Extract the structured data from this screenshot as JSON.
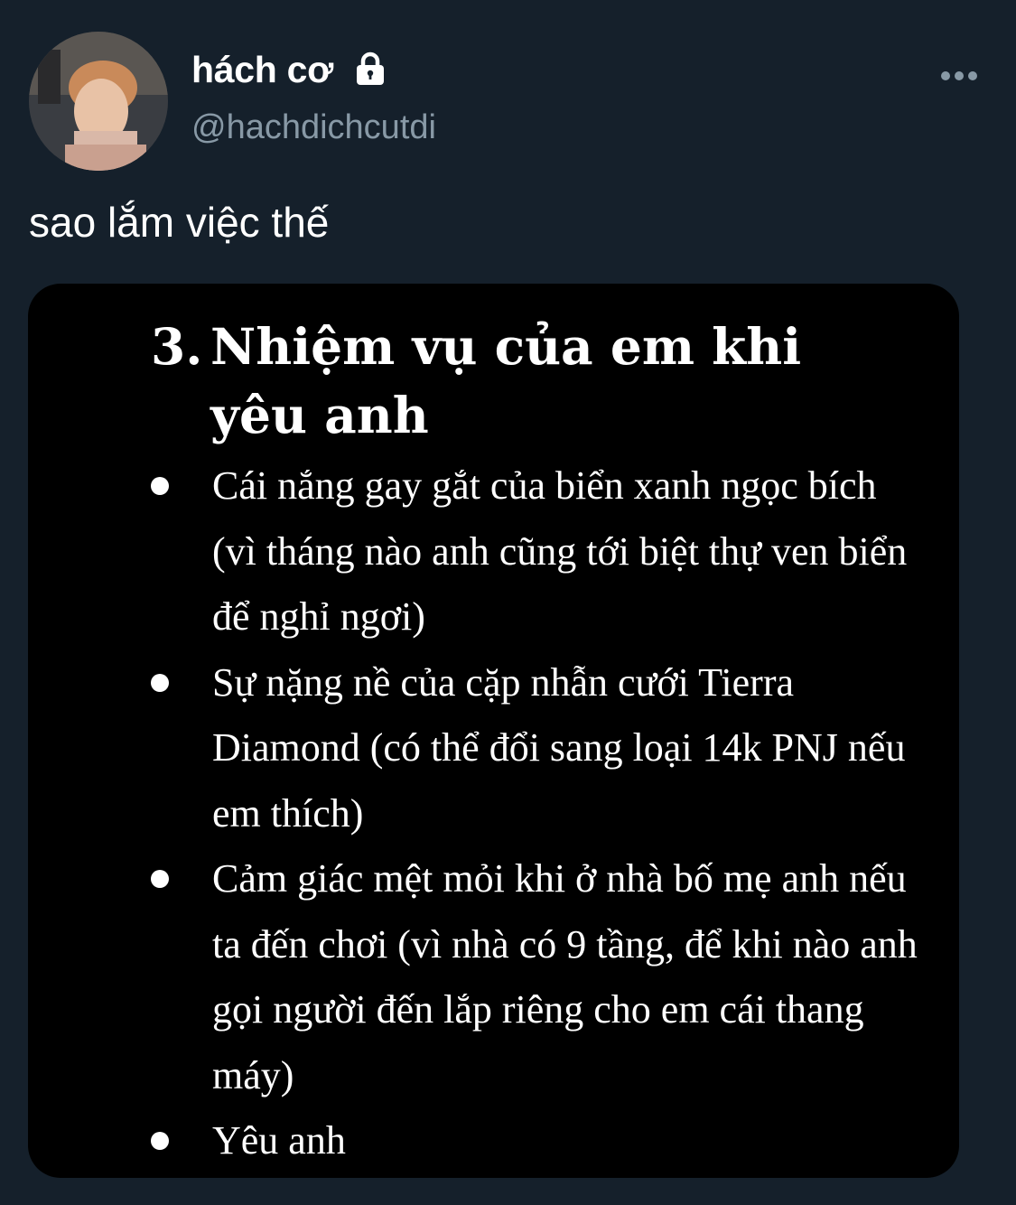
{
  "user": {
    "display_name": "hách cơ",
    "handle": "@hachdichcutdi",
    "protected_icon": "lock-icon",
    "avatar_icon": "avatar"
  },
  "tweet": {
    "text": "sao lắm việc thế",
    "more_icon": "more-icon"
  },
  "media": {
    "heading_number": "3.",
    "heading_text": "Nhiệm vụ của em khi yêu anh",
    "items": [
      {
        "text": " Cái nắng gay gắt của biển xanh ngọc bích (vì tháng nào anh cũng tới biệt thự ven biển để nghỉ ngơi)"
      },
      {
        "text": "Sự nặng nề của cặp nhẫn cưới Tierra Diamond (có thể đổi sang loại 14k PNJ nếu em thích)"
      },
      {
        "text": "Cảm giác mệt mỏi khi ở nhà bố mẹ anh nếu ta đến chơi (vì nhà có 9 tầng, để khi nào anh gọi người đến lắp riêng cho em cái thang máy)"
      },
      {
        "text": "Yêu anh"
      }
    ]
  },
  "colors": {
    "background": "#15202b",
    "handle_gray": "#8899a6",
    "media_bg": "#000000"
  }
}
